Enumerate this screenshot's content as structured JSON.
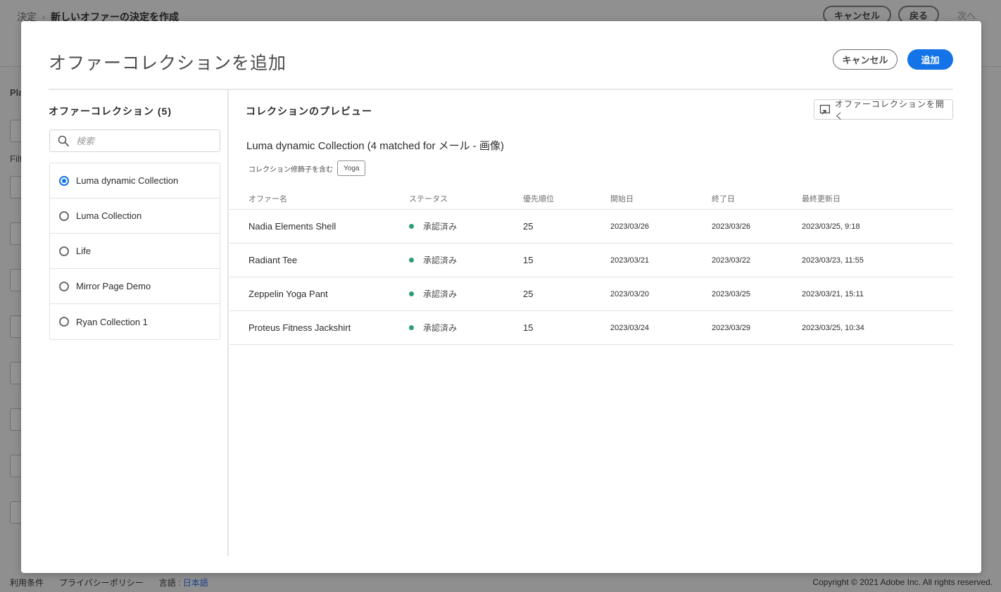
{
  "background": {
    "breadcrumb": {
      "root": "決定",
      "separator": "›",
      "current": "新しいオファーの決定を作成"
    },
    "actions": {
      "cancel": "キャンセル",
      "back": "戻る",
      "next": "次へ"
    },
    "left_heading": "Pla",
    "filter_label": "Filt",
    "footer": {
      "terms": "利用条件",
      "privacy": "プライバシーポリシー",
      "language_label": "言語 :",
      "language_value": "日本語",
      "copyright": "Copyright ©  2021 Adobe Inc.  All rights reserved."
    }
  },
  "modal": {
    "title": "オファーコレクションを追加",
    "cancel_label": "キャンセル",
    "add_label": "追加",
    "left": {
      "heading": "オファーコレクション (5)",
      "search_placeholder": "検索",
      "collections": [
        {
          "label": "Luma dynamic Collection",
          "selected": true
        },
        {
          "label": "Luma Collection",
          "selected": false
        },
        {
          "label": "Life",
          "selected": false
        },
        {
          "label": "Mirror Page Demo",
          "selected": false
        },
        {
          "label": "Ryan Collection 1",
          "selected": false
        }
      ]
    },
    "preview": {
      "heading": "コレクションのプレビュー",
      "open_collection_label": "オファーコレクションを開く",
      "collection_title": "Luma dynamic Collection (4 matched for メール - 画像)",
      "modifier_label": "コレクション修飾子を含む",
      "modifier_tag": "Yoga",
      "table": {
        "headers": {
          "name": "オファー名",
          "status": "ステータス",
          "priority": "優先順位",
          "start": "開始日",
          "end": "終了日",
          "modified": "最終更新日"
        },
        "rows": [
          {
            "name": "Nadia Elements Shell",
            "status": "承認済み",
            "priority": "25",
            "start": "2023/03/26",
            "end": "2023/03/26",
            "modified": "2023/03/25, 9:18"
          },
          {
            "name": "Radiant Tee",
            "status": "承認済み",
            "priority": "15",
            "start": "2023/03/21",
            "end": "2023/03/22",
            "modified": "2023/03/23, 11:55"
          },
          {
            "name": "Zeppelin Yoga Pant",
            "status": "承認済み",
            "priority": "25",
            "start": "2023/03/20",
            "end": "2023/03/25",
            "modified": "2023/03/21, 15:11"
          },
          {
            "name": "Proteus Fitness Jackshirt",
            "status": "承認済み",
            "priority": "15",
            "start": "2023/03/24",
            "end": "2023/03/29",
            "modified": "2023/03/25, 10:34"
          }
        ]
      }
    }
  },
  "colors": {
    "primary": "#1473e6",
    "status_approved": "#2d9d78"
  }
}
